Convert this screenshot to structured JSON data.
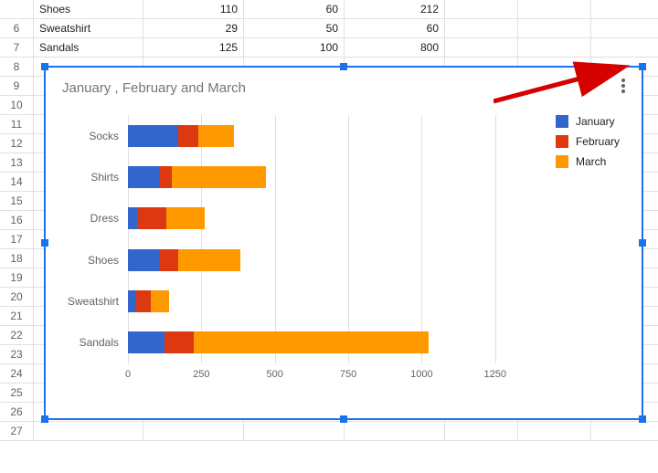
{
  "rows_visible_top": [
    {
      "n": "",
      "a": "Shoes",
      "b": "110",
      "c": "60",
      "d": "212"
    },
    {
      "n": "6",
      "a": "Sweatshirt",
      "b": "29",
      "c": "50",
      "d": "60"
    },
    {
      "n": "7",
      "a": "Sandals",
      "b": "125",
      "c": "100",
      "d": "800"
    }
  ],
  "row_numbers_rest": [
    "8",
    "9",
    "10",
    "11",
    "12",
    "13",
    "14",
    "15",
    "16",
    "17",
    "18",
    "19",
    "20",
    "21",
    "22",
    "23",
    "24",
    "25",
    "26",
    "27"
  ],
  "chart_title": "January , February  and March",
  "legend": {
    "items": [
      {
        "label": "January",
        "color": "#3366cc"
      },
      {
        "label": "February",
        "color": "#dc3912"
      },
      {
        "label": "March",
        "color": "#ff9900"
      }
    ]
  },
  "x_ticks": [
    "0",
    "250",
    "500",
    "750",
    "1000",
    "1250"
  ],
  "chart_data": {
    "type": "bar",
    "orientation": "horizontal-stacked",
    "title": "January , February  and March",
    "xlabel": "",
    "ylabel": "",
    "xlim": [
      0,
      1400
    ],
    "categories": [
      "Socks",
      "Shirts",
      "Dress",
      "Shoes",
      "Sweatshirt",
      "Sandals"
    ],
    "series": [
      {
        "name": "January",
        "color": "#3366cc",
        "values": [
          170,
          110,
          30,
          110,
          29,
          125
        ]
      },
      {
        "name": "February",
        "color": "#dc3912",
        "values": [
          70,
          40,
          100,
          60,
          50,
          100
        ]
      },
      {
        "name": "March",
        "color": "#ff9900",
        "values": [
          120,
          320,
          130,
          212,
          60,
          800
        ]
      }
    ],
    "x_ticks": [
      0,
      250,
      500,
      750,
      1000,
      1250
    ],
    "legend_position": "right"
  }
}
